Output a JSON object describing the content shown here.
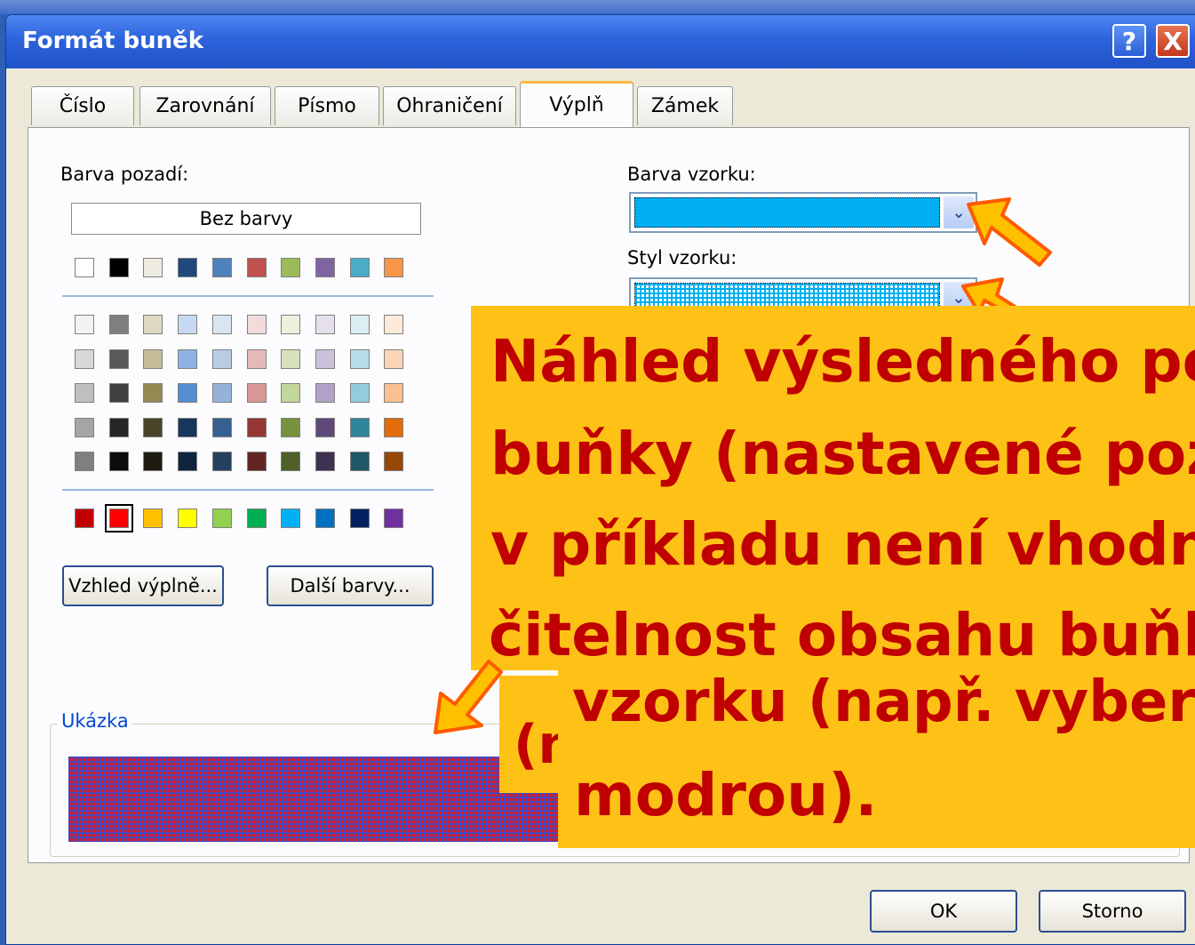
{
  "window": {
    "title": "Formát buněk"
  },
  "titlebar": {
    "help_label": "?",
    "close_label": "X"
  },
  "tabs": [
    {
      "label": "Číslo"
    },
    {
      "label": "Zarovnání"
    },
    {
      "label": "Písmo"
    },
    {
      "label": "Ohraničení"
    },
    {
      "label": "Výplň",
      "active": true
    },
    {
      "label": "Zámek"
    }
  ],
  "fill": {
    "background_label": "Barva pozadí:",
    "no_color_label": "Bez barvy",
    "palette_top": [
      "#ffffff",
      "#000000",
      "#eeece1",
      "#1f497d",
      "#4f81bd",
      "#c0504d",
      "#9bbb59",
      "#8064a2",
      "#4bacc6",
      "#f79646"
    ],
    "palette_tints": [
      [
        "#f2f2f2",
        "#7f7f7f",
        "#ddd9c3",
        "#c6d9f0",
        "#dbe5f1",
        "#f2dcdb",
        "#ebf1dd",
        "#e5e0ec",
        "#dbeef3",
        "#fdeada"
      ],
      [
        "#d8d8d8",
        "#595959",
        "#c4bd97",
        "#8db3e2",
        "#b8cce4",
        "#e5b9b7",
        "#d7e3bc",
        "#ccc1d9",
        "#b7dde8",
        "#fbd5b5"
      ],
      [
        "#bfbfbf",
        "#3f3f3f",
        "#938953",
        "#548dd4",
        "#95b3d7",
        "#d99694",
        "#c3d69b",
        "#b2a2c7",
        "#92cddc",
        "#fac08f"
      ],
      [
        "#a5a5a5",
        "#262626",
        "#494429",
        "#17365d",
        "#366092",
        "#953734",
        "#76923c",
        "#5f497a",
        "#31859b",
        "#e36c09"
      ],
      [
        "#7f7f7f",
        "#0c0c0c",
        "#1d1b10",
        "#0f243e",
        "#244061",
        "#632423",
        "#4f6128",
        "#3f3151",
        "#205867",
        "#974806"
      ]
    ],
    "palette_standard": [
      "#c00000",
      "#ff0000",
      "#ffc000",
      "#ffff00",
      "#92d050",
      "#00b050",
      "#00b0f0",
      "#0070c0",
      "#002060",
      "#7030a0"
    ],
    "selected_standard_index": 1,
    "fill_effects_button": "Vzhled výplně...",
    "more_colors_button": "Další barvy...",
    "pattern_color_label": "Barva vzorku:",
    "pattern_color_value": "#00b0f0",
    "pattern_style_label": "Styl vzorku:"
  },
  "sample": {
    "label": "Ukázka"
  },
  "callouts": {
    "main_lines": [
      "Náhled výsledného po",
      "buňky (nastavené poz",
      "v příkladu není vhodn",
      "čitelnost obsahu buňk"
    ],
    "back_line": "(n",
    "lower_lines": [
      "vzorku (např. vyber",
      "modrou)."
    ]
  },
  "buttons": {
    "ok": "OK",
    "cancel": "Storno"
  },
  "colors": {
    "callout_fill": "#fec217",
    "callout_text": "#c00000",
    "arrow_stroke": "#ff5a00",
    "arrow_fill": "#ffc000"
  }
}
